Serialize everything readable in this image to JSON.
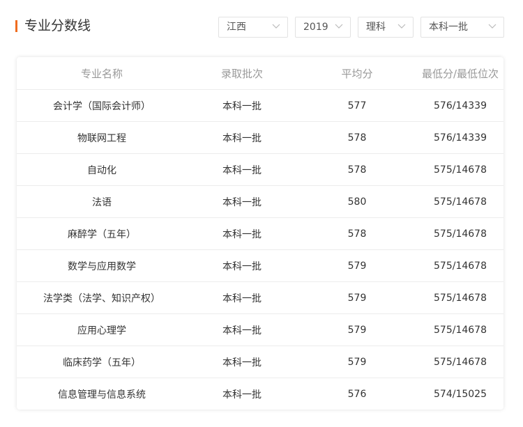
{
  "header": {
    "title": "专业分数线",
    "accent_color": "#ef6c1f"
  },
  "filters": {
    "province": "江西",
    "year": "2019",
    "subject": "理科",
    "batch": "本科一批"
  },
  "table": {
    "columns": [
      "专业名称",
      "录取批次",
      "平均分",
      "最低分/最低位次"
    ],
    "rows": [
      {
        "major": "会计学（国际会计师）",
        "batch": "本科一批",
        "avg": "577",
        "min": "576/14339"
      },
      {
        "major": "物联网工程",
        "batch": "本科一批",
        "avg": "578",
        "min": "576/14339"
      },
      {
        "major": "自动化",
        "batch": "本科一批",
        "avg": "578",
        "min": "575/14678"
      },
      {
        "major": "法语",
        "batch": "本科一批",
        "avg": "580",
        "min": "575/14678"
      },
      {
        "major": "麻醉学（五年）",
        "batch": "本科一批",
        "avg": "578",
        "min": "575/14678"
      },
      {
        "major": "数学与应用数学",
        "batch": "本科一批",
        "avg": "579",
        "min": "575/14678"
      },
      {
        "major": "法学类（法学、知识产权）",
        "batch": "本科一批",
        "avg": "579",
        "min": "575/14678"
      },
      {
        "major": "应用心理学",
        "batch": "本科一批",
        "avg": "579",
        "min": "575/14678"
      },
      {
        "major": "临床药学（五年）",
        "batch": "本科一批",
        "avg": "579",
        "min": "575/14678"
      },
      {
        "major": "信息管理与信息系统",
        "batch": "本科一批",
        "avg": "576",
        "min": "574/15025"
      }
    ]
  }
}
